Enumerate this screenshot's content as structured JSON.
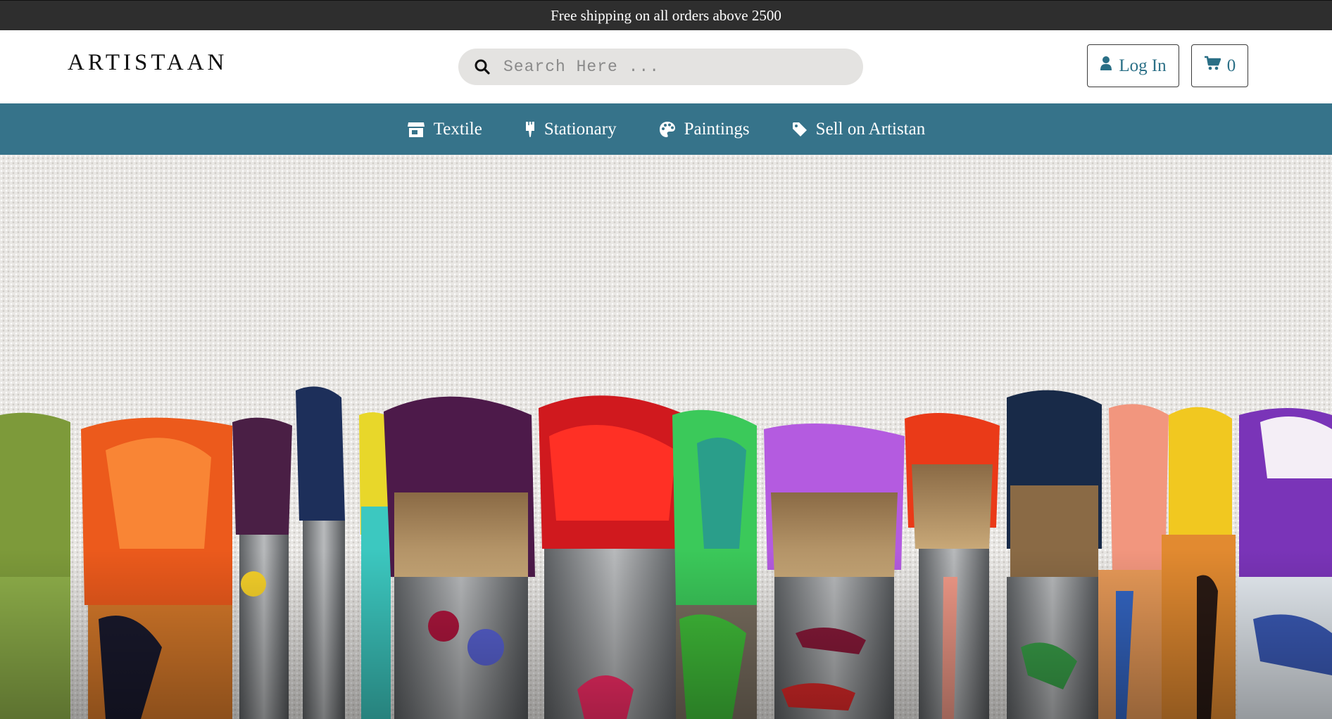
{
  "announcement": {
    "text": "Free shipping on all orders above 2500"
  },
  "header": {
    "logo": "ARTISTAAN",
    "search": {
      "placeholder": "Search Here ..."
    },
    "login_label": "Log In",
    "cart_count": "0"
  },
  "nav": {
    "items": [
      {
        "label": "Textile",
        "icon": "store-icon"
      },
      {
        "label": "Stationary",
        "icon": "paint-brush-icon"
      },
      {
        "label": "Paintings",
        "icon": "palette-icon"
      },
      {
        "label": "Sell on Artistan",
        "icon": "tag-icon"
      }
    ]
  },
  "hero": {
    "image": "paint-brushes-banner"
  },
  "colors": {
    "nav_bg": "#36738a",
    "accent": "#2a6f86",
    "announce_bg": "#2e2e2e",
    "search_bg": "#e4e3e1"
  }
}
